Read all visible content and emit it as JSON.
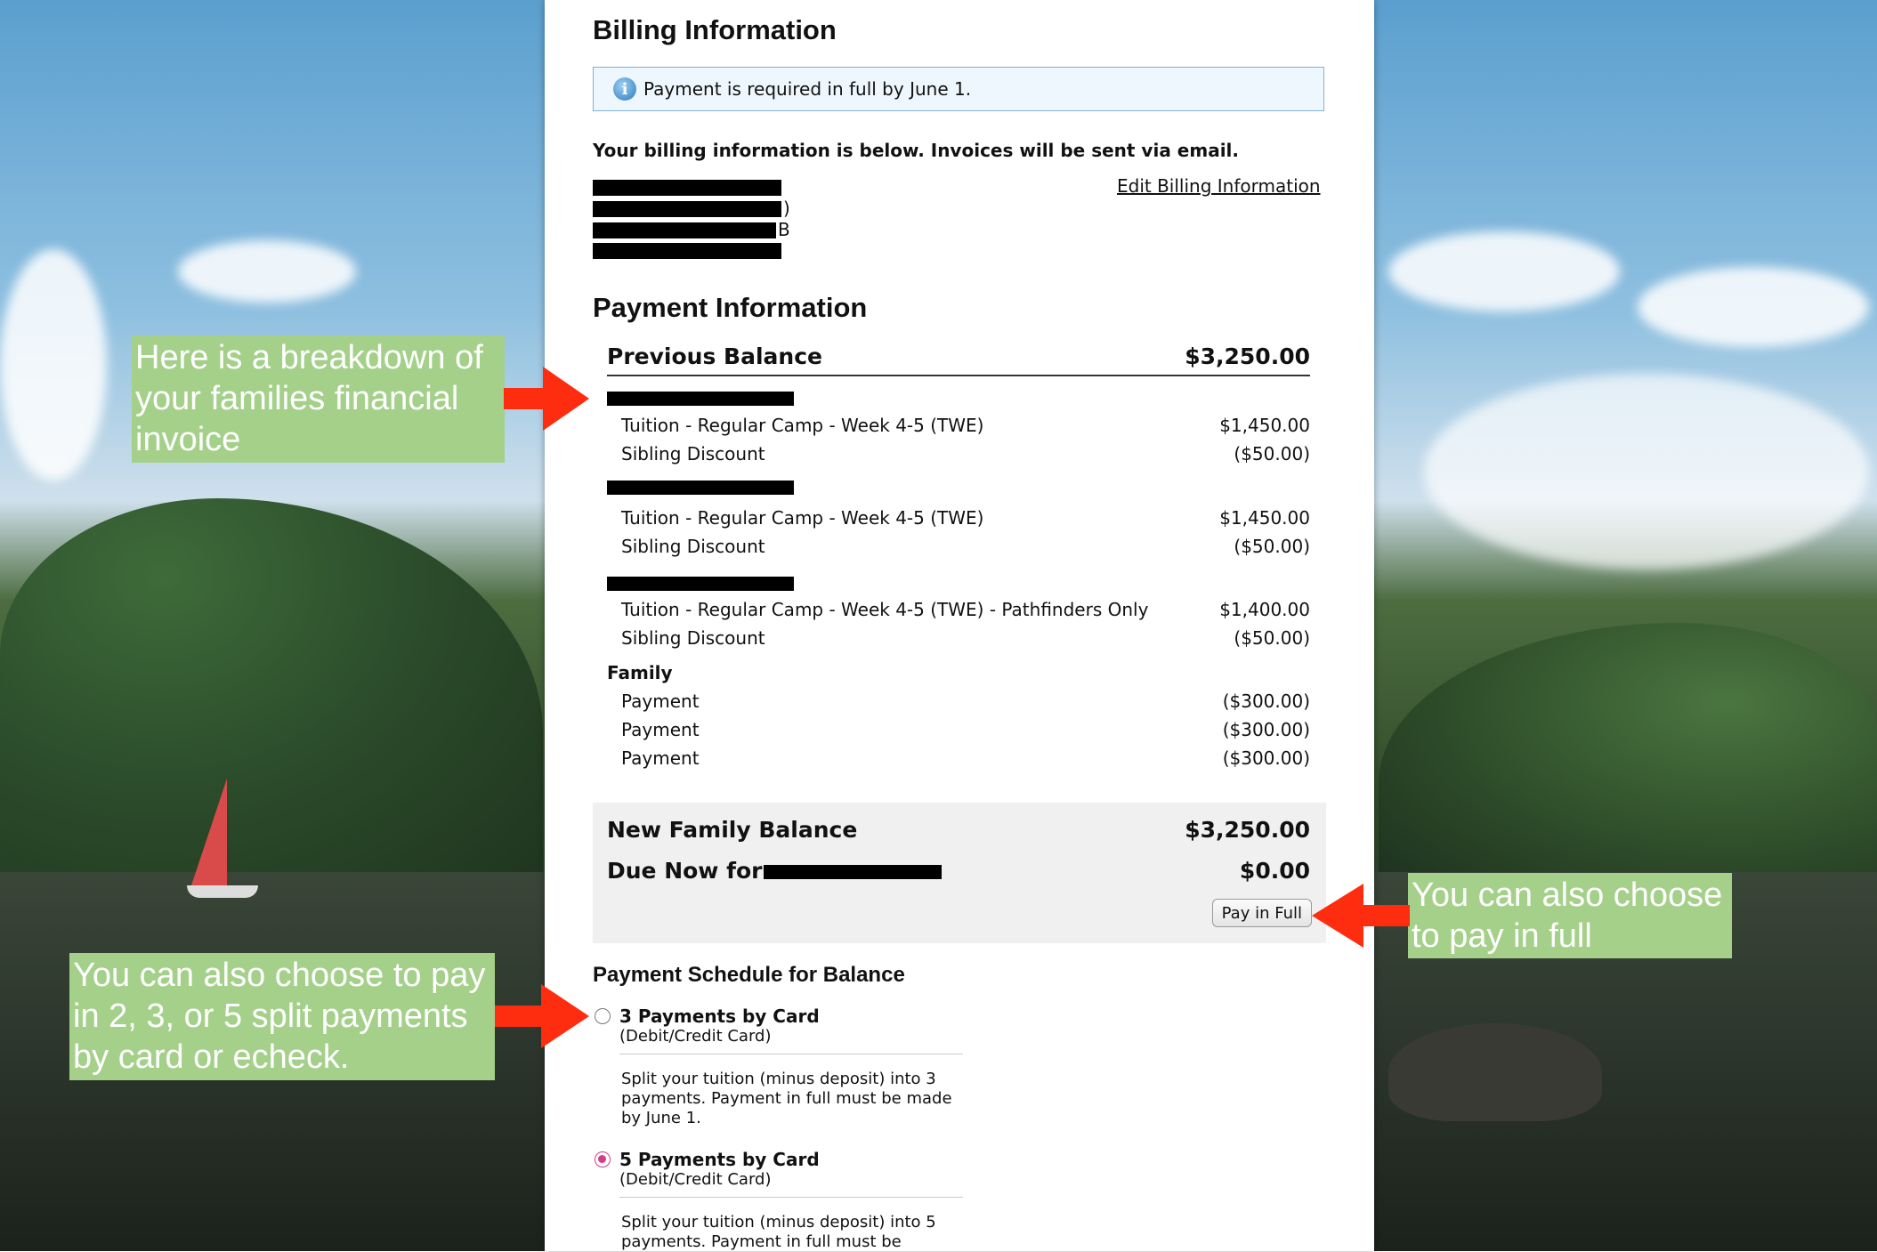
{
  "billing": {
    "title": "Billing Information",
    "notice": "Payment is required in full by June 1.",
    "intro": "Your billing information is below. Invoices will be sent via email.",
    "edit_link": "Edit Billing Information",
    "address_lines": [
      "",
      ")",
      "B",
      ""
    ]
  },
  "payment": {
    "title": "Payment Information",
    "previous_balance_label": "Previous Balance",
    "previous_balance_value": "$3,250.00",
    "groups": [
      {
        "name": "",
        "items": [
          {
            "label": "Tuition - Regular Camp - Week 4-5 (TWE)",
            "amount": "$1,450.00"
          },
          {
            "label": "Sibling Discount",
            "amount": "($50.00)"
          }
        ]
      },
      {
        "name": "",
        "items": [
          {
            "label": "Tuition - Regular Camp - Week 4-5 (TWE)",
            "amount": "$1,450.00"
          },
          {
            "label": "Sibling Discount",
            "amount": "($50.00)"
          }
        ]
      },
      {
        "name": "",
        "items": [
          {
            "label": "Tuition - Regular Camp - Week 4-5 (TWE) - Pathfinders Only",
            "amount": "$1,400.00"
          },
          {
            "label": "Sibling Discount",
            "amount": "($50.00)"
          }
        ]
      },
      {
        "name": "Family",
        "items": [
          {
            "label": "Payment",
            "amount": "($300.00)"
          },
          {
            "label": "Payment",
            "amount": "($300.00)"
          },
          {
            "label": "Payment",
            "amount": "($300.00)"
          }
        ]
      }
    ]
  },
  "summary": {
    "new_balance_label": "New Family Balance",
    "new_balance_value": "$3,250.00",
    "due_now_label": "Due Now for",
    "due_now_value": "$0.00",
    "pay_in_full_label": "Pay in Full"
  },
  "schedule": {
    "title": "Payment Schedule for Balance",
    "options": [
      {
        "title": "3 Payments by Card",
        "subtitle": "(Debit/Credit Card)",
        "description": "Split your tuition (minus deposit) into 3 payments. Payment in full must be made by June 1.",
        "selected": false
      },
      {
        "title": "5 Payments by Card",
        "subtitle": "(Debit/Credit Card)",
        "description": "Split your tuition (minus deposit) into 5 payments. Payment in full must be",
        "selected": true
      }
    ]
  },
  "callouts": {
    "breakdown": "Here is a breakdown of your families financial invoice",
    "split": "You can also choose to pay in 2, 3, or 5 split payments by card or echeck.",
    "pay_full": "You can also choose to pay in full"
  },
  "colors": {
    "callout_bg": "#a4d08a",
    "arrow": "#ff2d0f",
    "radio_selected": "#d63c8d"
  }
}
